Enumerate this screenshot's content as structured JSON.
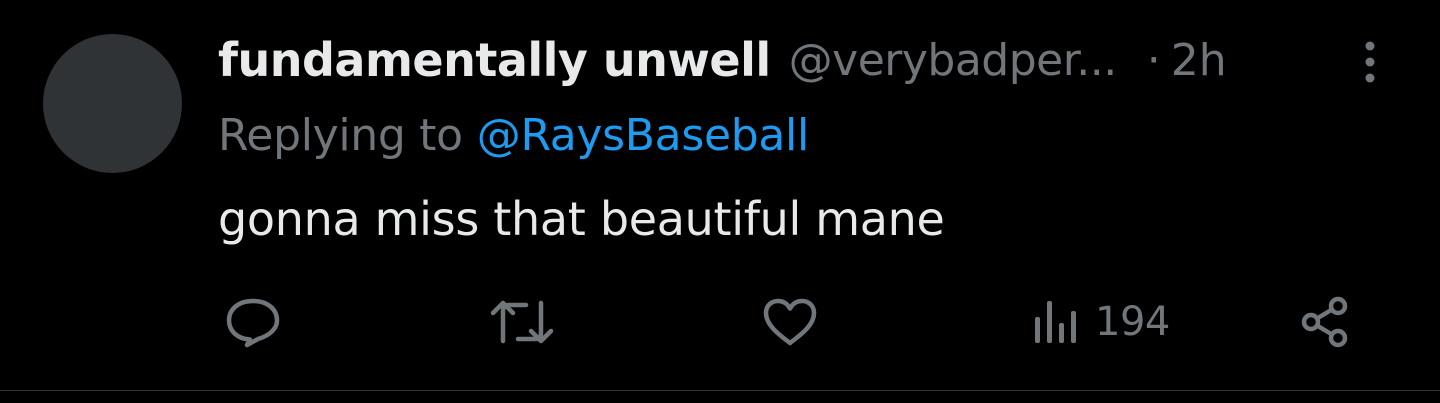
{
  "tweet": {
    "author": {
      "display_name": "fundamentally unwell",
      "handle": "@verybadper...",
      "avatar": "blank-avatar"
    },
    "separator": "·",
    "timestamp": "2h",
    "reply_prefix": "Replying to",
    "reply_to": "@RaysBaseball",
    "text": "gonna miss that beautiful mane",
    "views": "194"
  },
  "icons": {
    "more": "more-vertical-icon",
    "reply": "reply-icon",
    "retweet": "retweet-icon",
    "like": "heart-icon",
    "views": "analytics-icon",
    "share": "share-icon"
  },
  "colors": {
    "background": "#000000",
    "primary_text": "#e7e9ea",
    "secondary_text": "#71767b",
    "link": "#1d9bf0",
    "avatar_placeholder": "#2f3336",
    "divider": "#2f3336"
  }
}
